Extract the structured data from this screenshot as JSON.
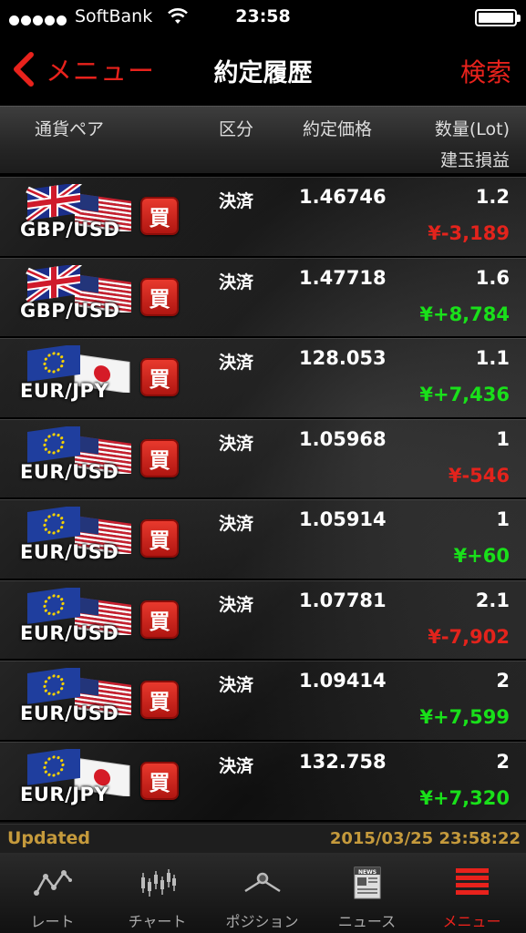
{
  "status_bar": {
    "carrier": "SoftBank",
    "time": "23:58"
  },
  "nav": {
    "back_label": "メニュー",
    "title": "約定履歴",
    "search_label": "検索"
  },
  "columns": {
    "pair": "通貨ペア",
    "kubun": "区分",
    "price": "約定価格",
    "quantity": "数量(Lot)",
    "pl": "建玉損益"
  },
  "rows": [
    {
      "pair": "GBP/USD",
      "flags": "gbp-usd",
      "side": "買",
      "kubun": "決済",
      "price": "1.46746",
      "quantity": "1.2",
      "pl": "¥-3,189",
      "pl_sign": "neg"
    },
    {
      "pair": "GBP/USD",
      "flags": "gbp-usd",
      "side": "買",
      "kubun": "決済",
      "price": "1.47718",
      "quantity": "1.6",
      "pl": "¥+8,784",
      "pl_sign": "pos"
    },
    {
      "pair": "EUR/JPY",
      "flags": "eur-jpy",
      "side": "買",
      "kubun": "決済",
      "price": "128.053",
      "quantity": "1.1",
      "pl": "¥+7,436",
      "pl_sign": "pos"
    },
    {
      "pair": "EUR/USD",
      "flags": "eur-usd",
      "side": "買",
      "kubun": "決済",
      "price": "1.05968",
      "quantity": "1",
      "pl": "¥-546",
      "pl_sign": "neg"
    },
    {
      "pair": "EUR/USD",
      "flags": "eur-usd",
      "side": "買",
      "kubun": "決済",
      "price": "1.05914",
      "quantity": "1",
      "pl": "¥+60",
      "pl_sign": "pos"
    },
    {
      "pair": "EUR/USD",
      "flags": "eur-usd",
      "side": "買",
      "kubun": "決済",
      "price": "1.07781",
      "quantity": "2.1",
      "pl": "¥-7,902",
      "pl_sign": "neg"
    },
    {
      "pair": "EUR/USD",
      "flags": "eur-usd",
      "side": "買",
      "kubun": "決済",
      "price": "1.09414",
      "quantity": "2",
      "pl": "¥+7,599",
      "pl_sign": "pos"
    },
    {
      "pair": "EUR/JPY",
      "flags": "eur-jpy",
      "side": "買",
      "kubun": "決済",
      "price": "132.758",
      "quantity": "2",
      "pl": "¥+7,320",
      "pl_sign": "pos"
    }
  ],
  "updated": {
    "label": "Updated",
    "timestamp": "2015/03/25 23:58:22"
  },
  "tabs": [
    {
      "label": "レート",
      "icon": "rate-icon",
      "active": false
    },
    {
      "label": "チャート",
      "icon": "chart-icon",
      "active": false
    },
    {
      "label": "ポジション",
      "icon": "position-icon",
      "active": false
    },
    {
      "label": "ニュース",
      "icon": "news-icon",
      "active": false
    },
    {
      "label": "メニュー",
      "icon": "menu-icon",
      "active": true
    }
  ],
  "colors": {
    "accent_red": "#e8221c",
    "profit_green": "#19e01a",
    "loss_red": "#e3231c",
    "updated_gold": "#c59a3c"
  }
}
